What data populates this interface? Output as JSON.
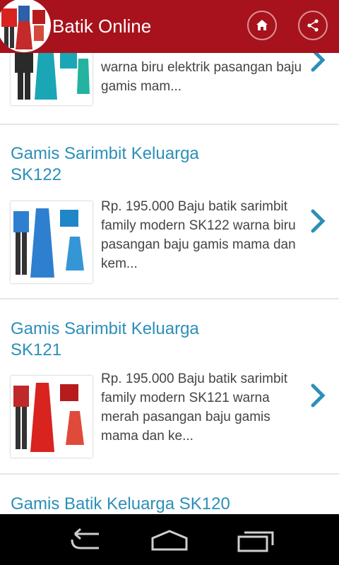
{
  "app": {
    "title": "Batik Online",
    "brand_color": "#a8121c",
    "accent_color": "#2c8fb8"
  },
  "header": {
    "logo_icon": "batik-logo",
    "home_icon": "home-icon",
    "share_icon": "share-icon"
  },
  "items": [
    {
      "title": "",
      "description": "warna biru elektrik pasangan baju gamis mam...",
      "thumb_color": "#1aa6b5"
    },
    {
      "title": "Gamis Sarimbit Keluarga SK122",
      "description": "Rp. 195.000 Baju batik sarimbit family modern SK122 warna biru pasangan baju gamis mama dan kem...",
      "thumb_color": "#2e7fd0"
    },
    {
      "title": "Gamis Sarimbit Keluarga SK121",
      "description": "Rp. 195.000 Baju batik sarimbit family modern SK121 warna merah pasangan baju gamis mama dan ke...",
      "thumb_color": "#d8231f"
    },
    {
      "title": "Gamis Batik Keluarga SK120",
      "description": "",
      "thumb_color": ""
    }
  ],
  "navigation": {
    "back_icon": "back-icon",
    "home_icon": "nav-home-icon",
    "recents_icon": "recents-icon"
  }
}
